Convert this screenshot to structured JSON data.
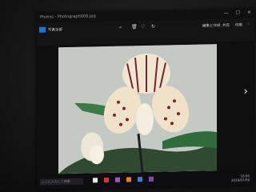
{
  "window": {
    "app_title": "Photos - Photograph006.jpg",
    "controls": [
      "—",
      "☐",
      "✕"
    ]
  },
  "toolbar": {
    "left_label": "写真全部",
    "icons": [
      "zoom-in-icon",
      "delete-icon",
      "favorite-icon",
      "rotate-icon"
    ],
    "right_labels": [
      "編集と作成",
      "共有",
      "印刷",
      "⋯"
    ]
  },
  "taskbar": {
    "search_placeholder": "ここに入力して検索",
    "time": "16:00",
    "date": "2019/07/09"
  },
  "photo": {
    "subject": "orchid",
    "colors": {
      "petal": "#f1e6cf",
      "spots": "#7a2132",
      "leaf": "#2f6b3c",
      "bg": "#c5c9c4"
    }
  }
}
